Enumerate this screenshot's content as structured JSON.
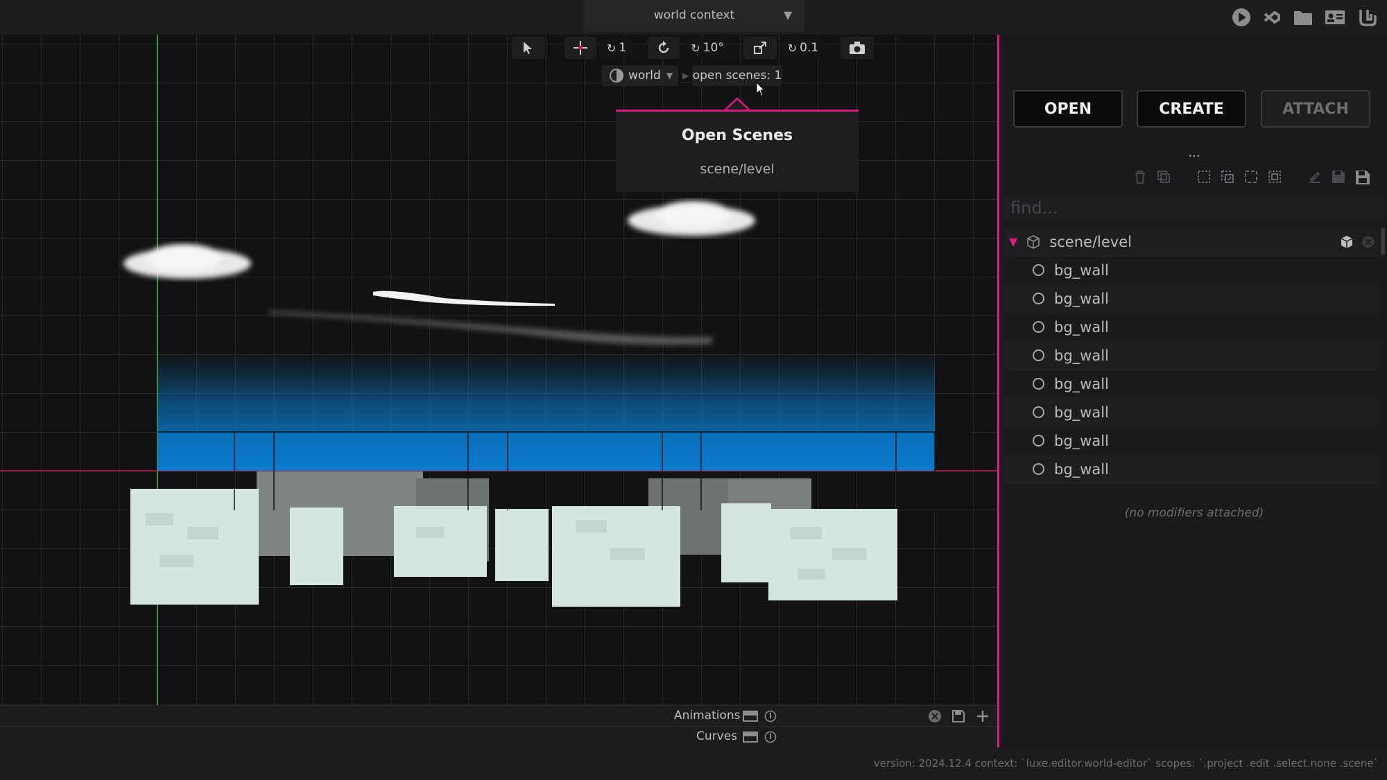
{
  "header": {
    "context_title": "world context"
  },
  "top_icons": [
    "play-icon",
    "vscode-icon",
    "folder-icon",
    "id-card-icon",
    "luxe-logo-icon"
  ],
  "toolbar": {
    "tools": [
      "select-tool-icon",
      "move-tool-icon",
      "rotate-tool-icon",
      "scale-tool-icon",
      "camera-icon"
    ],
    "move_snap": "1",
    "rotate_snap": "10°",
    "scale_snap": "0.1",
    "world_label": "world",
    "open_scenes_label": "open scenes: 1"
  },
  "popup": {
    "title": "Open Scenes",
    "items": [
      "scene/level"
    ]
  },
  "panels": {
    "animations_label": "Animations",
    "curves_label": "Curves"
  },
  "status_text": "version: 2024.12.4 context: `luxe.editor.world-editor` scopes: `.project .edit .select.none .scene`",
  "right_panel": {
    "buttons": {
      "open": "OPEN",
      "create": "CREATE",
      "attach": "ATTACH"
    },
    "ellipsis": "...",
    "find_placeholder": "find...",
    "scene_name": "scene/level",
    "entities": [
      "bg_wall",
      "bg_wall",
      "bg_wall",
      "bg_wall",
      "bg_wall",
      "bg_wall",
      "bg_wall",
      "bg_wall"
    ],
    "no_modifiers": "(no modifiers attached)"
  },
  "colors": {
    "accent": "#e0197d",
    "selection_blue": "#0a7fd4",
    "grid": "#2a2a2e"
  }
}
